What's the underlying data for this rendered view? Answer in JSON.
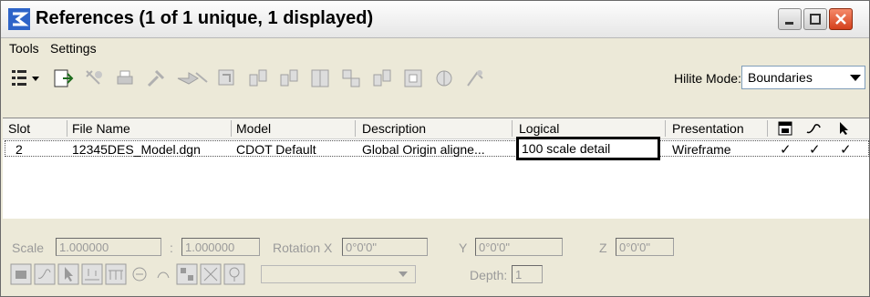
{
  "window": {
    "title": "References (1 of 1 unique, 1 displayed)",
    "controls": [
      "minimize-icon",
      "maximize-icon",
      "close-icon"
    ]
  },
  "menu": {
    "items": [
      {
        "label": "Tools"
      },
      {
        "label": "Settings"
      }
    ]
  },
  "toolbar": {
    "icons": [
      "list-view-icon",
      "attach-reference-icon",
      "detach-icon",
      "print-icon",
      "settings-icon",
      "move-icon",
      "copy-icon",
      "scale-icon",
      "rotate-icon",
      "mirror-h-icon",
      "mirror-v-icon",
      "clip-boundary-icon",
      "clip-mask-icon",
      "clip-delete-icon",
      "reload-icon",
      "exchange-icon"
    ],
    "hilite_label": "Hilite Mode:",
    "hilite_value": "Boundaries"
  },
  "table": {
    "columns": [
      "Slot",
      "File Name",
      "Model",
      "Description",
      "Logical",
      "Presentation"
    ],
    "flag_columns": [
      "display-icon",
      "snap-icon",
      "locate-icon"
    ],
    "rows": [
      {
        "slot": "2",
        "file_name": "12345DES_Model.dgn",
        "model": "CDOT Default",
        "description": "Global Origin aligne...",
        "logical": "100 scale detail",
        "presentation": "Wireframe",
        "flags": [
          "✓",
          "✓",
          "✓"
        ]
      }
    ]
  },
  "settings": {
    "scale_label": "Scale",
    "scale_value1": "1.000000",
    "colon": ":",
    "scale_value2": "1.000000",
    "rotation_x_label": "Rotation X",
    "rotation_x_value": "0°0'0\"",
    "y_label": "Y",
    "y_value": "0°0'0\"",
    "z_label": "Z",
    "z_value": "0°0'0\"",
    "depth_label": "Depth:",
    "depth_value": "1"
  },
  "colors": {
    "window_bg": "#ece9d8",
    "highlight_border": "#000000",
    "disabled_text": "#9a9a9a"
  }
}
